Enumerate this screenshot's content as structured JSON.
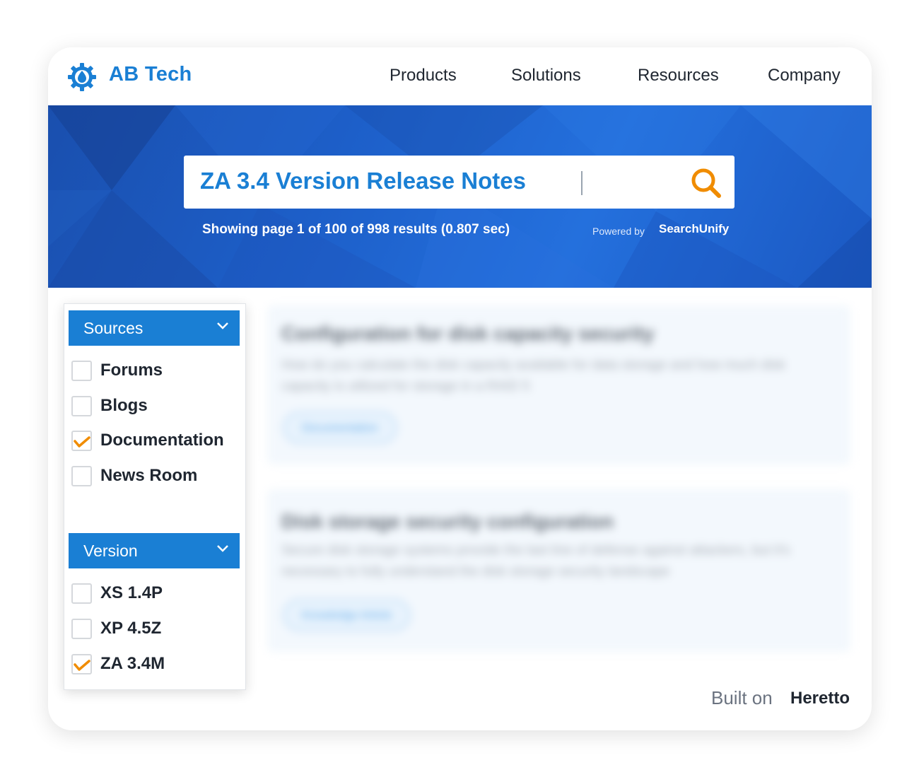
{
  "nav": {
    "brand": "AB Tech",
    "items": [
      "Products",
      "Solutions",
      "Resources",
      "Company"
    ]
  },
  "search": {
    "query": "ZA 3.4 Version Release Notes",
    "results_text": "Showing page 1 of 100 of 998 results (0.807 sec)",
    "powered_by": "Powered by",
    "provider": "SearchUnify"
  },
  "filters": {
    "sources": {
      "title": "Sources",
      "options": [
        {
          "label": "Forums",
          "checked": false
        },
        {
          "label": "Blogs",
          "checked": false
        },
        {
          "label": "Documentation",
          "checked": true
        },
        {
          "label": "News Room",
          "checked": false
        }
      ]
    },
    "version": {
      "title": "Version",
      "options": [
        {
          "label": "XS 1.4P",
          "checked": false
        },
        {
          "label": "XP 4.5Z",
          "checked": false
        },
        {
          "label": "ZA 3.4M",
          "checked": true
        }
      ]
    }
  },
  "results": [
    {
      "title": "Configuration for disk capacity security",
      "description": "How do you calculate the disk capacity available for data storage and how much disk capacity is utilized for storage in a RAID 5",
      "tag": "Documentation"
    },
    {
      "title": "Disk storage security configuration",
      "description": "Secure disk storage systems provide the last line of defense against attackers, but it's necessary to fully understand the disk storage security landscape",
      "tag": "Knowledge Article"
    }
  ],
  "footer": {
    "built_on": "Built on",
    "platform": "Heretto"
  },
  "colors": {
    "accent": "#1a7fd4",
    "check": "#f08c00",
    "search_icon": "#f08c00"
  }
}
